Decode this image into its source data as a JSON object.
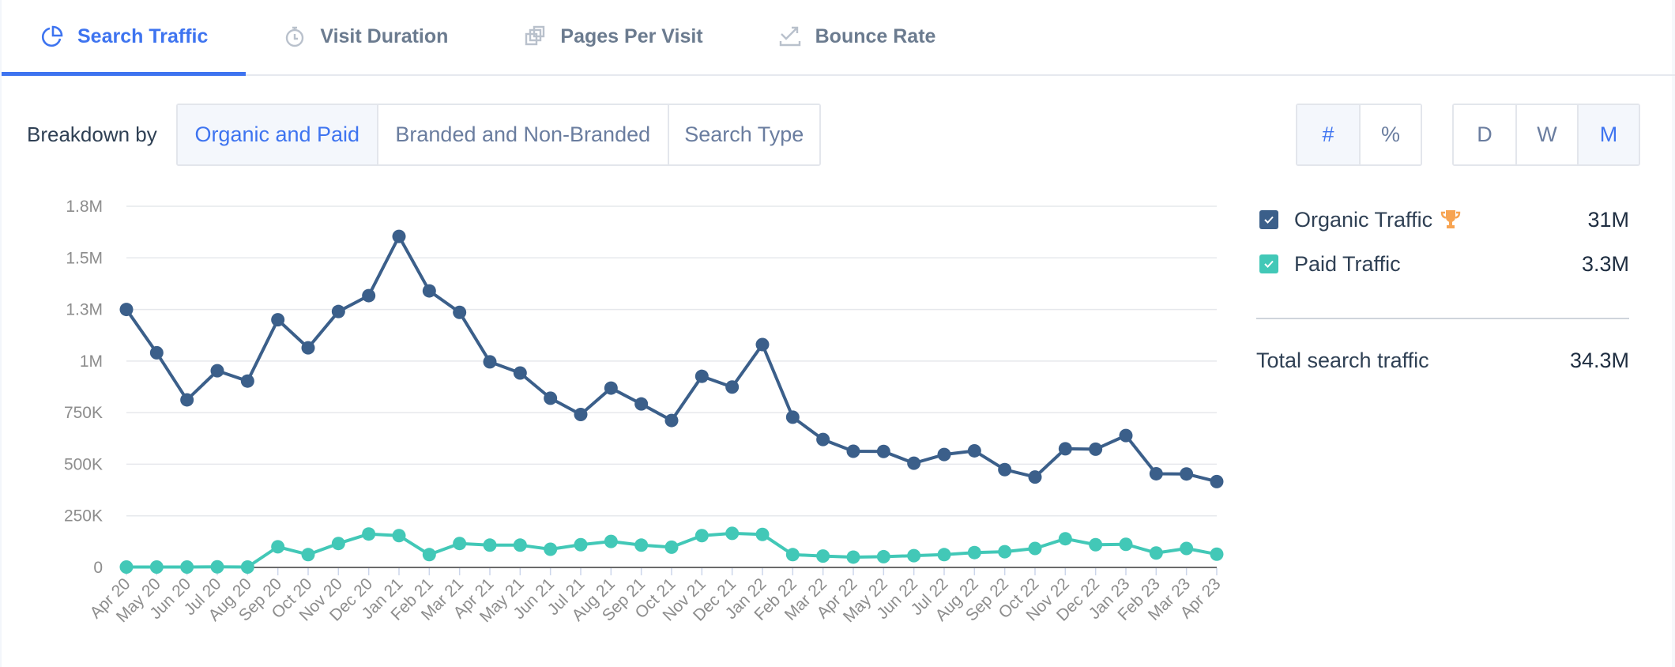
{
  "tabs": [
    {
      "label": "Search Traffic",
      "icon": "pie-chart-icon",
      "active": true
    },
    {
      "label": "Visit Duration",
      "icon": "stopwatch-icon",
      "active": false
    },
    {
      "label": "Pages Per Visit",
      "icon": "stacked-pages-icon",
      "active": false
    },
    {
      "label": "Bounce Rate",
      "icon": "bounce-arrow-icon",
      "active": false
    }
  ],
  "breakdown": {
    "label": "Breakdown by",
    "options": [
      "Organic and Paid",
      "Branded and Non-Branded",
      "Search Type"
    ],
    "selected": "Organic and Paid"
  },
  "unit_toggle": {
    "options": [
      "#",
      "%"
    ],
    "selected": "#"
  },
  "period_toggle": {
    "options": [
      "D",
      "W",
      "M"
    ],
    "selected": "M"
  },
  "colors": {
    "accent": "#3e74f0",
    "organic": "#3b5f8a",
    "paid": "#42c8b7",
    "trophy": "#f7a452"
  },
  "legend": {
    "items": [
      {
        "label": "Organic Traffic",
        "value": "31M",
        "checked": true,
        "icon": "trophy-icon"
      },
      {
        "label": "Paid Traffic",
        "value": "3.3M",
        "checked": true
      }
    ],
    "total_label": "Total search traffic",
    "total_value": "34.3M"
  },
  "chart_data": {
    "type": "line",
    "title": "",
    "xlabel": "",
    "ylabel": "",
    "ylim": [
      0,
      1750000
    ],
    "y_ticks": [
      0,
      250000,
      500000,
      750000,
      1000000,
      1250000,
      1500000,
      1750000
    ],
    "y_tick_labels": [
      "0",
      "250K",
      "500K",
      "750K",
      "1M",
      "1.3M",
      "1.5M",
      "1.8M"
    ],
    "grid": true,
    "legend_position": "right",
    "x": [
      "Apr 20",
      "May 20",
      "Jun 20",
      "Jul 20",
      "Aug 20",
      "Sep 20",
      "Oct 20",
      "Nov 20",
      "Dec 20",
      "Jan 21",
      "Feb 21",
      "Mar 21",
      "Apr 21",
      "May 21",
      "Jun 21",
      "Jul 21",
      "Aug 21",
      "Sep 21",
      "Oct 21",
      "Nov 21",
      "Dec 21",
      "Jan 22",
      "Feb 22",
      "Mar 22",
      "Apr 22",
      "May 22",
      "Jun 22",
      "Jul 22",
      "Aug 22",
      "Sep 22",
      "Oct 22",
      "Nov 22",
      "Dec 22",
      "Jan 23",
      "Feb 23",
      "Mar 23",
      "Apr 23"
    ],
    "series": [
      {
        "name": "Organic Traffic",
        "values": [
          1250000,
          1040000,
          812000,
          953000,
          903000,
          1200000,
          1064000,
          1240000,
          1317000,
          1604000,
          1340000,
          1236000,
          996000,
          942000,
          820000,
          741000,
          869000,
          792000,
          712000,
          926000,
          874000,
          1080000,
          728000,
          620000,
          563000,
          562000,
          505000,
          547000,
          565000,
          474000,
          438000,
          575000,
          573000,
          639000,
          454000,
          453000,
          416000
        ]
      },
      {
        "name": "Paid Traffic",
        "values": [
          2000,
          2000,
          2000,
          3000,
          2000,
          100000,
          62000,
          116000,
          162000,
          154000,
          62000,
          116000,
          108000,
          108000,
          88000,
          110000,
          126000,
          108000,
          98000,
          154000,
          165000,
          160000,
          62000,
          55000,
          50000,
          52000,
          57000,
          62000,
          72000,
          76000,
          92000,
          139000,
          110000,
          112000,
          70000,
          92000,
          64000
        ]
      }
    ]
  }
}
